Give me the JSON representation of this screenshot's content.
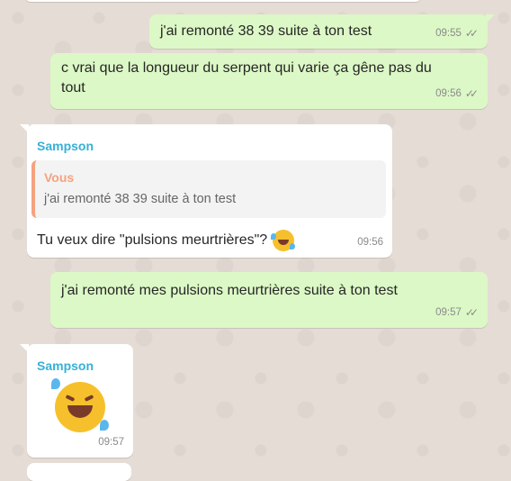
{
  "messages": [
    {
      "text": "j'ai remonté 38 39 suite à ton test",
      "time": "09:55",
      "direction": "outgoing"
    },
    {
      "text": "c vrai que la longueur du serpent qui varie ça gêne pas du tout",
      "time": "09:56",
      "direction": "outgoing"
    },
    {
      "sender": "Sampson",
      "quote_sender": "Vous",
      "quote_text": "j'ai remonté 38 39 suite à ton test",
      "text": "Tu veux dire \"pulsions meurtrières\"?",
      "emoji": "rolling-on-floor-laughing-emoji",
      "time": "09:56",
      "direction": "incoming"
    },
    {
      "text": "j'ai remonté mes pulsions meurtrières suite à ton test",
      "time": "09:57",
      "direction": "outgoing"
    },
    {
      "sender": "Sampson",
      "emoji": "rolling-on-floor-laughing-emoji",
      "time": "09:57",
      "direction": "incoming"
    }
  ],
  "colors": {
    "outgoing_bubble": "#dcf8c6",
    "incoming_bubble": "#ffffff",
    "sender_name": "#35b0d8",
    "quote_accent": "#f4a27f",
    "background": "#e5ddd5"
  }
}
